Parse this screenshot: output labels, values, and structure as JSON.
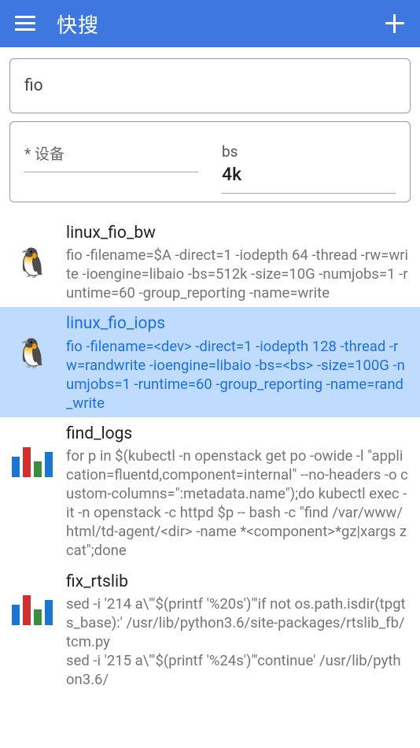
{
  "header": {
    "title": "快搜"
  },
  "search": {
    "query": "fio"
  },
  "params": {
    "device": {
      "label": "* 设备",
      "value": ""
    },
    "bs": {
      "label": "bs",
      "value": "4k"
    }
  },
  "items": [
    {
      "name": "linux_fio_bw",
      "cmd": "fio -filename=$A -direct=1 -iodepth 64 -thread -rw=write -ioengine=libaio -bs=512k -size=10G -numjobs=1 -runtime=60 -group_reporting -name=write",
      "icon": "penguin",
      "selected": false
    },
    {
      "name": "linux_fio_iops",
      "cmd": "fio -filename=<dev> -direct=1 -iodepth 128 -thread -rw=randwrite -ioengine=libaio -bs=<bs> -size=100G -numjobs=1 -runtime=60 -group_reporting -name=rand_write",
      "icon": "penguin",
      "selected": true
    },
    {
      "name": "find_logs",
      "cmd": "for p in $(kubectl -n openstack get po -owide -l \"application=fluentd,component=internal\" --no-headers -o custom-columns=\":metadata.name\");do kubectl exec -it -n openstack -c httpd $p -- bash -c \"find /var/www/html/td-agent/<dir> -name *<component>*gz|xargs zcat\";done",
      "icon": "barchart",
      "selected": false
    },
    {
      "name": "fix_rtslib",
      "cmd": "sed -i '214 a\\'\"$(printf '%20s')\"'if not os.path.isdir(tpgts_base):' /usr/lib/python3.6/site-packages/rtslib_fb/tcm.py\nsed -i '215 a\\'\"$(printf '%24s')\"'continue' /usr/lib/python3.6/",
      "icon": "barchart",
      "selected": false
    }
  ]
}
